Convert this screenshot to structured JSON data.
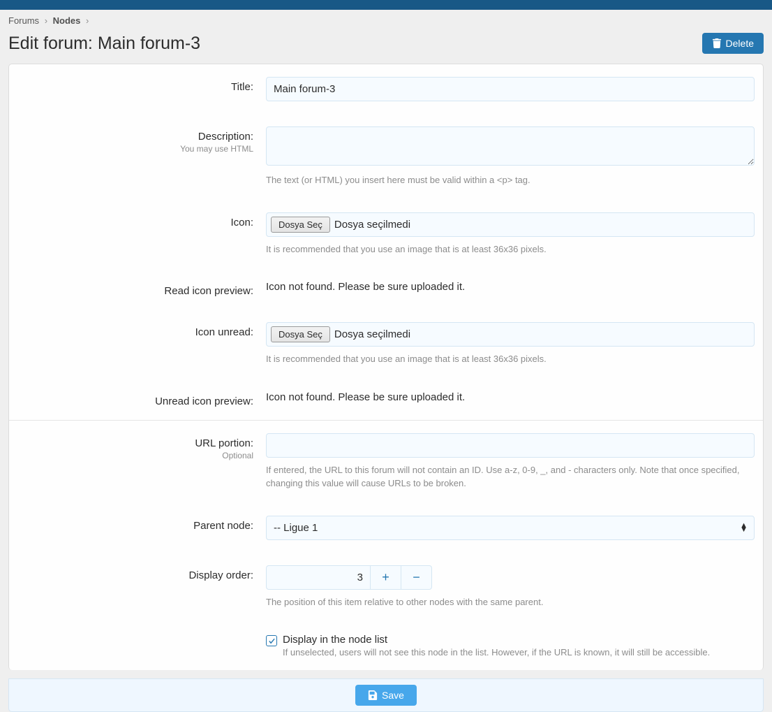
{
  "breadcrumb": {
    "item1": "Forums",
    "item2": "Nodes"
  },
  "header": {
    "title": "Edit forum: Main forum-3",
    "delete_label": "Delete"
  },
  "form": {
    "title": {
      "label": "Title:",
      "value": "Main forum-3"
    },
    "description": {
      "label": "Description:",
      "sub": "You may use HTML",
      "value": "",
      "hint_pre": "The text (or HTML) you insert here must be valid within a ",
      "hint_code": "<p>",
      "hint_post": " tag."
    },
    "icon": {
      "label": "Icon:",
      "btn": "Dosya Seç",
      "status": "Dosya seçilmedi",
      "hint": "It is recommended that you use an image that is at least 36x36 pixels."
    },
    "read_preview": {
      "label": "Read icon preview:",
      "text": "Icon not found. Please be sure uploaded it."
    },
    "icon_unread": {
      "label": "Icon unread:",
      "btn": "Dosya Seç",
      "status": "Dosya seçilmedi",
      "hint": "It is recommended that you use an image that is at least 36x36 pixels."
    },
    "unread_preview": {
      "label": "Unread icon preview:",
      "text": "Icon not found. Please be sure uploaded it."
    },
    "url_portion": {
      "label": "URL portion:",
      "sub": "Optional",
      "value": "",
      "hint": "If entered, the URL to this forum will not contain an ID. Use a-z, 0-9, _, and - characters only. Note that once specified, changing this value will cause URLs to be broken."
    },
    "parent_node": {
      "label": "Parent node:",
      "value": "-- Ligue 1"
    },
    "display_order": {
      "label": "Display order:",
      "value": "3",
      "hint": "The position of this item relative to other nodes with the same parent."
    },
    "display_in_list": {
      "label": "Display in the node list",
      "hint": "If unselected, users will not see this node in the list. However, if the URL is known, it will still be accessible."
    }
  },
  "save": {
    "label": "Save"
  }
}
